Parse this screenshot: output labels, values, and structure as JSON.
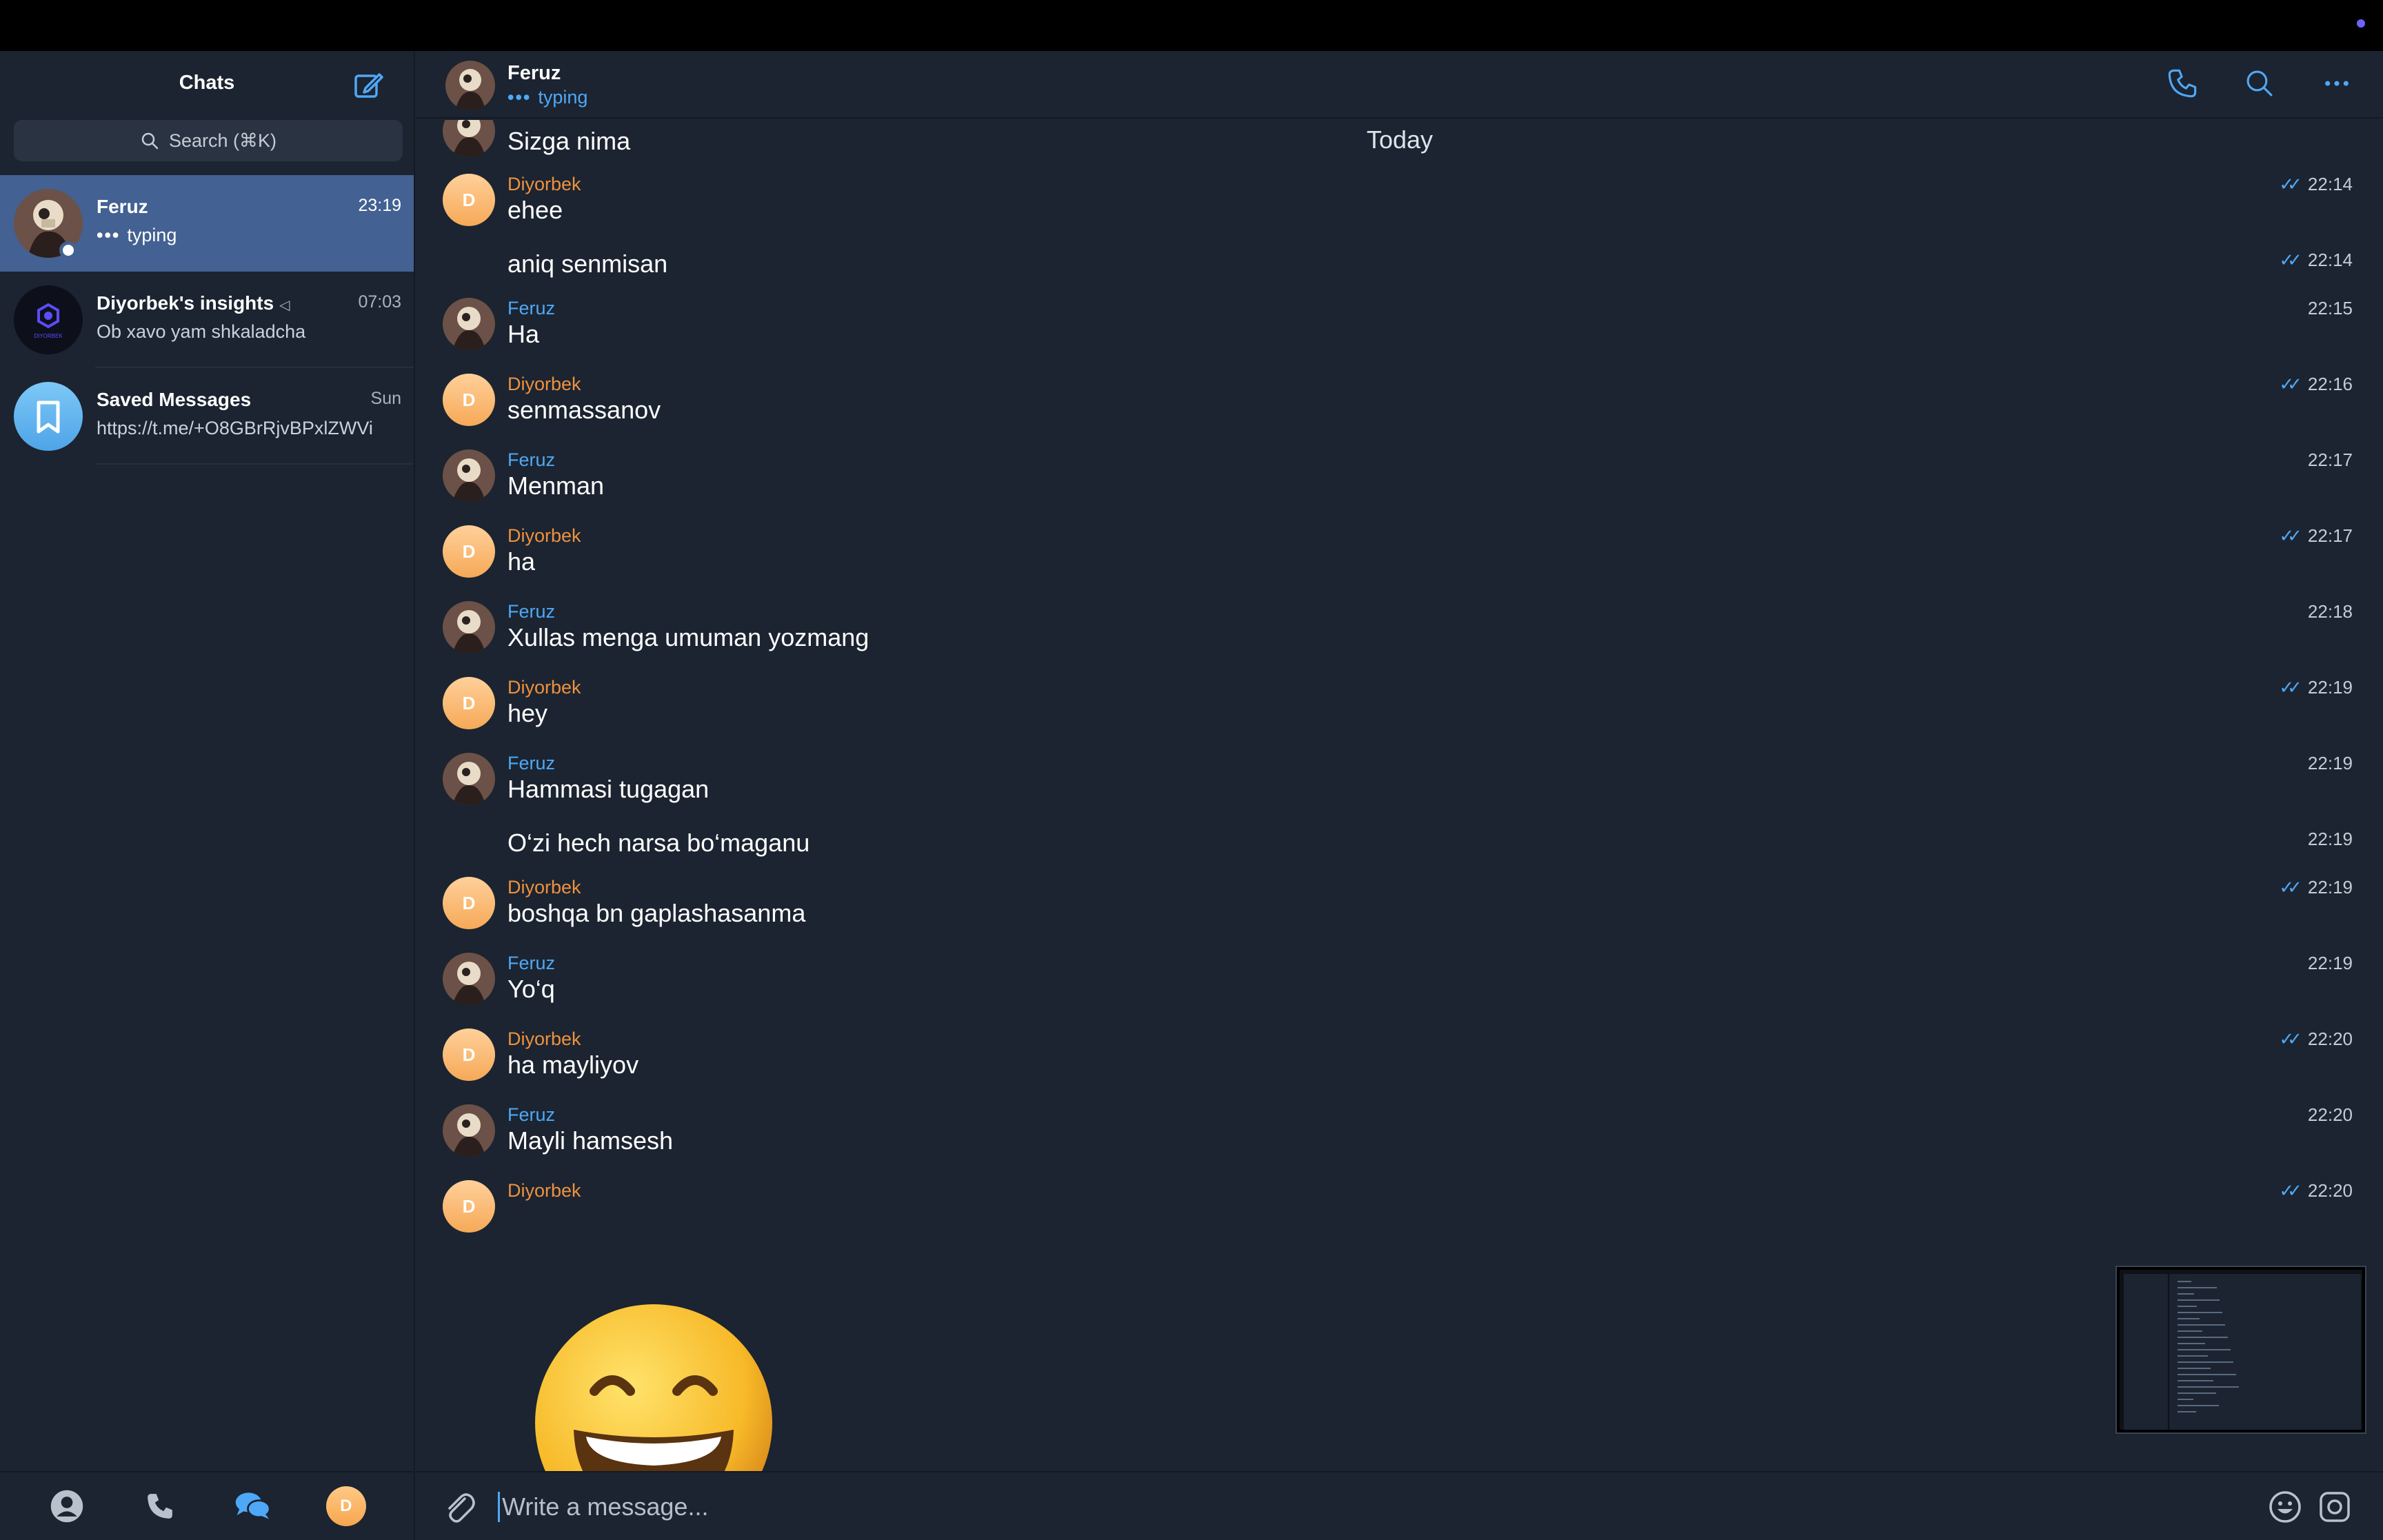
{
  "sidebar": {
    "title": "Chats",
    "search_placeholder": "Search (⌘K)",
    "chats": [
      {
        "name": "Feruz",
        "time": "23:19",
        "subtitle": "typing",
        "active": true
      },
      {
        "name": "Diyorbek's insights",
        "time": "07:03",
        "subtitle": "Ob xavo yam shkaladcha"
      },
      {
        "name": "Saved Messages",
        "time": "Sun",
        "subtitle": "https://t.me/+O8GBrRjvBPxlZWVi"
      }
    ],
    "channel_logo_text": "DIYORBEK",
    "bottom_avatar_letter": "D"
  },
  "header": {
    "name": "Feruz",
    "status": "typing",
    "typing_dots": "•••"
  },
  "date_separator": "Today",
  "messages": [
    {
      "sender": "",
      "text": "Sizga nima",
      "time": ""
    },
    {
      "sender": "Diyorbek",
      "text": "ehee",
      "time": "22:14",
      "read": true
    },
    {
      "sender": "",
      "text": "aniq senmisan",
      "time": "22:14",
      "read": true
    },
    {
      "sender": "Feruz",
      "text": "Ha",
      "time": "22:15"
    },
    {
      "sender": "Diyorbek",
      "text": "senmassanov",
      "time": "22:16",
      "read": true
    },
    {
      "sender": "Feruz",
      "text": "Menman",
      "time": "22:17"
    },
    {
      "sender": "Diyorbek",
      "text": "ha",
      "time": "22:17",
      "read": true
    },
    {
      "sender": "Feruz",
      "text": "Xullas menga umuman yozmang",
      "time": "22:18"
    },
    {
      "sender": "Diyorbek",
      "text": "hey",
      "time": "22:19",
      "read": true
    },
    {
      "sender": "Feruz",
      "text": "Hammasi tugagan",
      "time": "22:19"
    },
    {
      "sender": "",
      "text": "O‘zi hech narsa bo‘maganu",
      "time": "22:19"
    },
    {
      "sender": "Diyorbek",
      "text": "boshqa bn gaplashasanma",
      "time": "22:19",
      "read": true
    },
    {
      "sender": "Feruz",
      "text": "Yo‘q",
      "time": "22:19"
    },
    {
      "sender": "Diyorbek",
      "text": "ha mayliyov",
      "time": "22:20",
      "read": true
    },
    {
      "sender": "Feruz",
      "text": "Mayli hamsesh",
      "time": "22:20"
    },
    {
      "sender": "Diyorbek",
      "text": "",
      "time": "22:20",
      "read": true
    }
  ],
  "avatar_letter_d": "D",
  "composer": {
    "placeholder": "Write a message..."
  },
  "colors": {
    "accent": "#4fa8f7",
    "diyorbek": "#f0913e",
    "active_chat": "#436192",
    "background": "#1b2430"
  }
}
